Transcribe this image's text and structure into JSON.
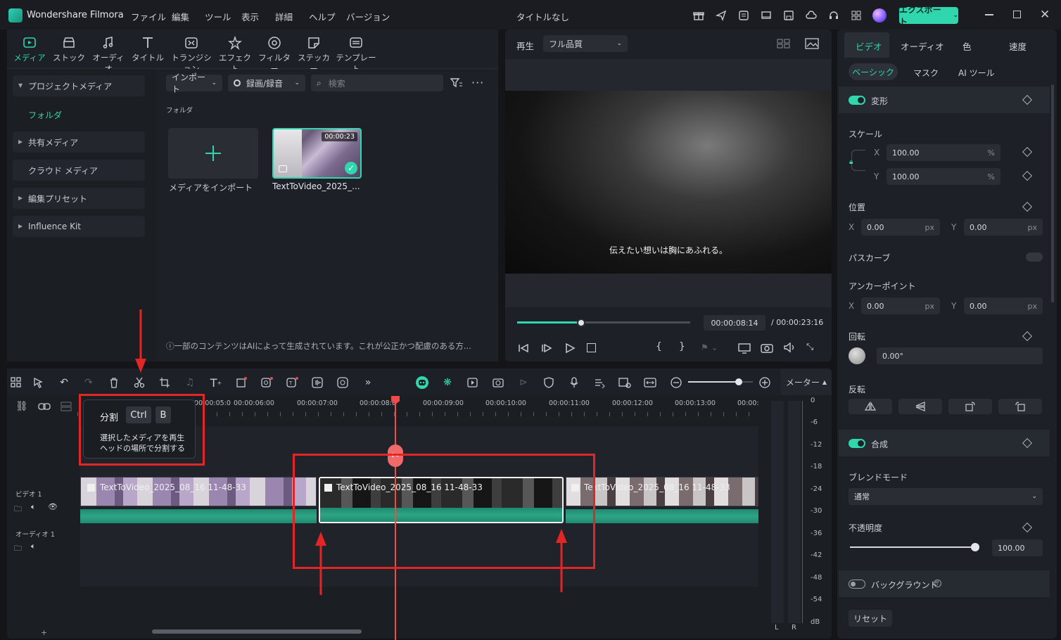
{
  "app": {
    "name": "Wondershare Filmora",
    "document_title": "タイトルなし",
    "export_label": "エクスポート"
  },
  "menu": [
    "ファイル",
    "編集",
    "ツール",
    "表示",
    "詳細",
    "ヘルプ",
    "バージョン"
  ],
  "media_tabs": [
    {
      "label": "メディア",
      "icon": "media-icon",
      "active": true
    },
    {
      "label": "ストック",
      "icon": "stock-icon"
    },
    {
      "label": "オーディオ",
      "icon": "music-icon"
    },
    {
      "label": "タイトル",
      "icon": "title-icon"
    },
    {
      "label": "トランジション",
      "icon": "transition-icon"
    },
    {
      "label": "エフェクト",
      "icon": "effect-icon"
    },
    {
      "label": "フィルター",
      "icon": "filter-icon"
    },
    {
      "label": "ステッカー",
      "icon": "sticker-icon"
    },
    {
      "label": "テンプレート",
      "icon": "template-icon"
    }
  ],
  "sidebar": {
    "project_media": "プロジェクトメディア",
    "folder": "フォルダ",
    "shared_media": "共有メディア",
    "cloud_media": "クラウド メディア",
    "edit_presets": "編集プリセット",
    "influence_kit": "Influence Kit"
  },
  "media_toolbar": {
    "import": "インポート",
    "record": "録画/録音",
    "search_placeholder": "検索"
  },
  "media_area": {
    "folder_label": "フォルダ",
    "import_tile_label": "メディアをインポート",
    "clip": {
      "name": "TextToVideo_2025_...",
      "duration": "00:00:23"
    },
    "ai_notice": "ⓘ一部のコンテンツはAIによって生成されています。これが公正かつ配慮のある方..."
  },
  "preview": {
    "play_label": "再生",
    "quality": "フル品質",
    "subtitle": "伝えたい想いは胸にあふれる。",
    "current_time": "00:00:08:14",
    "total_time": "/ 00:00:23:16",
    "progress": 0.37
  },
  "inspector": {
    "tabs": [
      "ビデオ",
      "オーディオ",
      "色",
      "速度"
    ],
    "subtabs": [
      "ベーシック",
      "マスク",
      "AI ツール"
    ],
    "transform": "変形",
    "scale": "スケール",
    "scale_x": "100.00",
    "scale_y": "100.00",
    "percent": "%",
    "position": "位置",
    "pos_x": "0.00",
    "pos_y": "0.00",
    "px": "px",
    "path_curve": "パスカーブ",
    "anchor": "アンカーポイント",
    "anchor_x": "0.00",
    "anchor_y": "0.00",
    "rotation": "回転",
    "rotation_value": "0.00°",
    "flip": "反転",
    "composite": "合成",
    "blend_mode": "ブレンドモード",
    "blend_value": "通常",
    "opacity": "不透明度",
    "opacity_value": "100.00",
    "opacity_level": 1.0,
    "background": "バックグラウンド",
    "reset": "リセット",
    "x": "X",
    "y": "Y"
  },
  "timeline": {
    "meter_label": "メーター",
    "ruler": [
      "00:00:05:0",
      "00:00:06:00",
      "00:00:07:00",
      "00:00:08:0",
      "00:00:09:00",
      "00:00:10:00",
      "00:00:11:00",
      "00:00:12:00",
      "00:00:13:00",
      "00:00:"
    ],
    "video_track": "ビデオ 1",
    "audio_track": "オーディオ 1",
    "clips": [
      "TextToVideo_2025_08_16 11-48-33",
      "TextToVideo_2025_08_16 11-48-33",
      "TextToVideo_2025_08_16 11-48-33"
    ],
    "db_scale": [
      "0",
      "-6",
      "-12",
      "-18",
      "-24",
      "-30",
      "-36",
      "-42",
      "-48",
      "-54",
      "dB"
    ],
    "meter_lr": [
      "L",
      "R"
    ],
    "zoom_level": 0.78
  },
  "tooltip": {
    "title": "分割",
    "key1": "Ctrl",
    "key2": "B",
    "desc_line1": "選択したメディアを再生",
    "desc_line2": "ヘッドの場所で分割する"
  },
  "colors": {
    "accent": "#30d6ad",
    "annotation_red": "#e22525",
    "playhead": "#f04a4a"
  }
}
